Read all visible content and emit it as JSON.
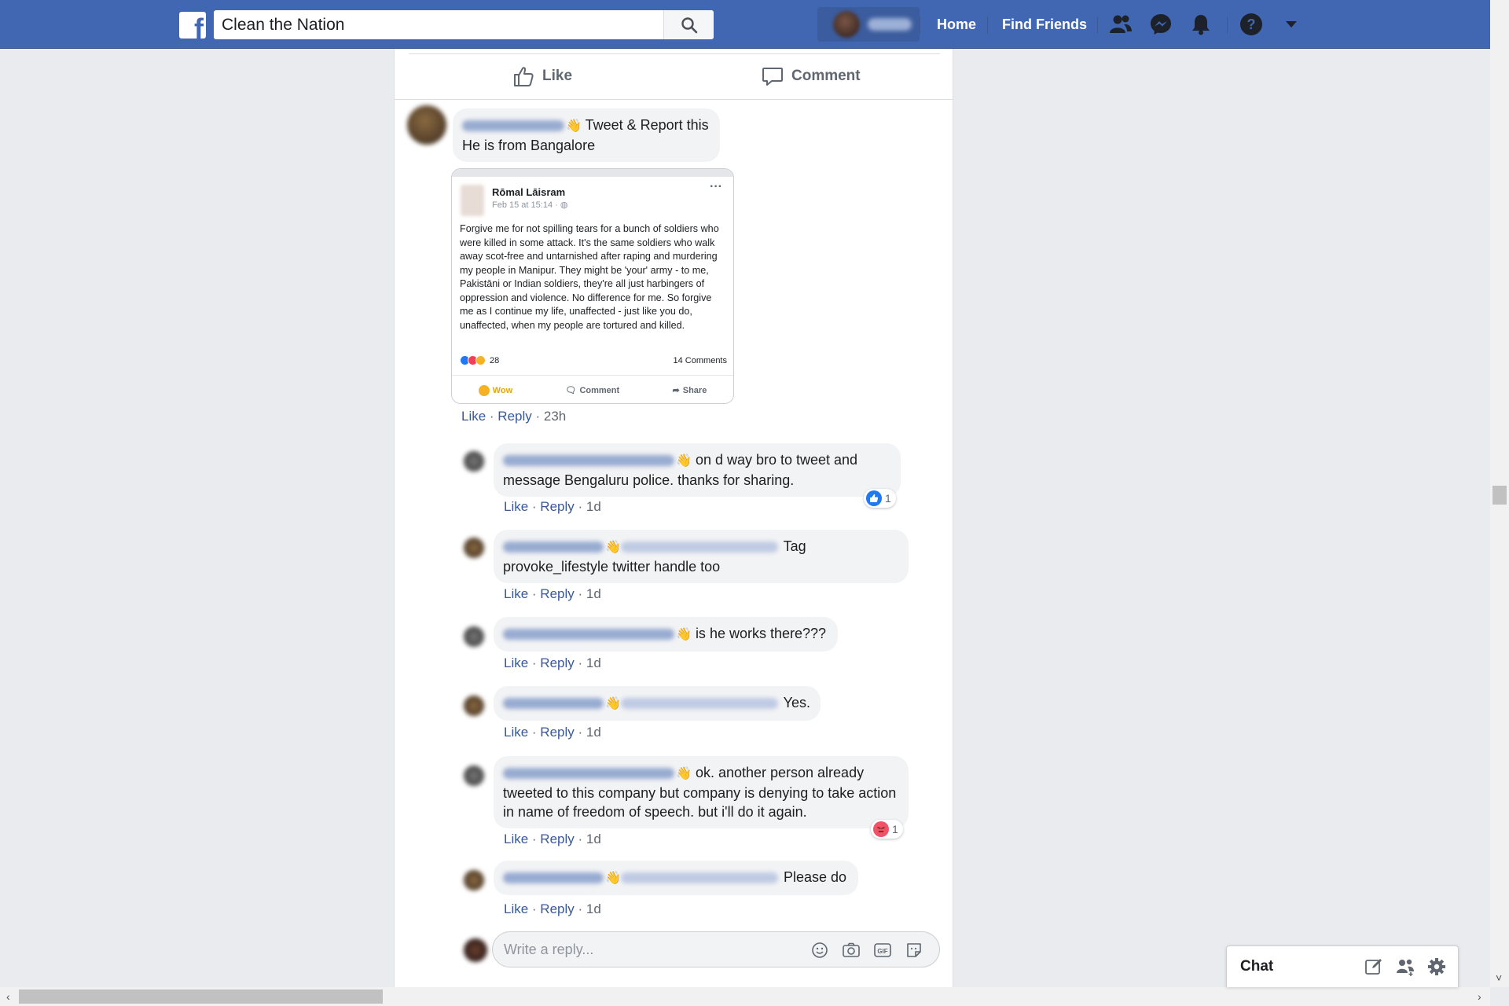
{
  "header": {
    "search_value": "Clean the Nation",
    "nav_home": "Home",
    "nav_find_friends": "Find Friends"
  },
  "post_actions": {
    "like_label": "Like",
    "comment_label": "Comment"
  },
  "main_comment": {
    "text_line1": "Tweet & Report this",
    "text_line2": "He is from Bangalore",
    "like_label": "Like",
    "reply_label": "Reply",
    "time": "23h"
  },
  "embedded_post": {
    "author": "Rōmal Lāisram",
    "date": "Feb 15 at 15:14 ·",
    "body": "Forgive me for not spilling tears for a bunch of soldiers who were killed in some attack. It's the same soldiers who walk away scot-free and untarnished after raping and murdering my people in Manipur. They might be 'your' army - to me, Pakistāni or Indian soldiers, they're all just harbingers of oppression and violence. No difference for me. So forgive me as I continue my life, unaffected - just like you do, unaffected, when my people are tortured and killed.",
    "reaction_count": "28",
    "comments_count": "14 Comments",
    "action_wow": "Wow",
    "action_comment": "Comment",
    "action_share": "Share"
  },
  "replies": [
    {
      "text": "on d way bro to tweet and message Bengaluru police. thanks for sharing.",
      "like": "Like",
      "reply": "Reply",
      "time": "1d",
      "reaction": "like",
      "reaction_count": "1"
    },
    {
      "text": "Tag provoke_lifestyle twitter handle too",
      "like": "Like",
      "reply": "Reply",
      "time": "1d"
    },
    {
      "text": "is he works there???",
      "like": "Like",
      "reply": "Reply",
      "time": "1d"
    },
    {
      "text": "Yes.",
      "like": "Like",
      "reply": "Reply",
      "time": "1d"
    },
    {
      "text": "ok. another person already tweeted to this company but company is denying to take action in name of freedom of speech. but i'll do it again.",
      "like": "Like",
      "reply": "Reply",
      "time": "1d",
      "reaction": "angry",
      "reaction_count": "1"
    },
    {
      "text": "Please do",
      "like": "Like",
      "reply": "Reply",
      "time": "1d"
    }
  ],
  "reply_input": {
    "placeholder": "Write a reply..."
  },
  "chat": {
    "label": "Chat"
  },
  "icons": {
    "logo": "facebook-logo",
    "search": "search-icon",
    "friends": "friend-requests-icon",
    "messenger": "messenger-icon",
    "notifications": "bell-icon",
    "help": "help-icon",
    "menu": "caret-down-icon",
    "hand": "waving-hand-icon"
  },
  "colors": {
    "brand": "#4267b2",
    "link": "#385898",
    "bubble": "#f2f3f5",
    "like_blue": "#2078f4",
    "angry": "#f25268"
  }
}
